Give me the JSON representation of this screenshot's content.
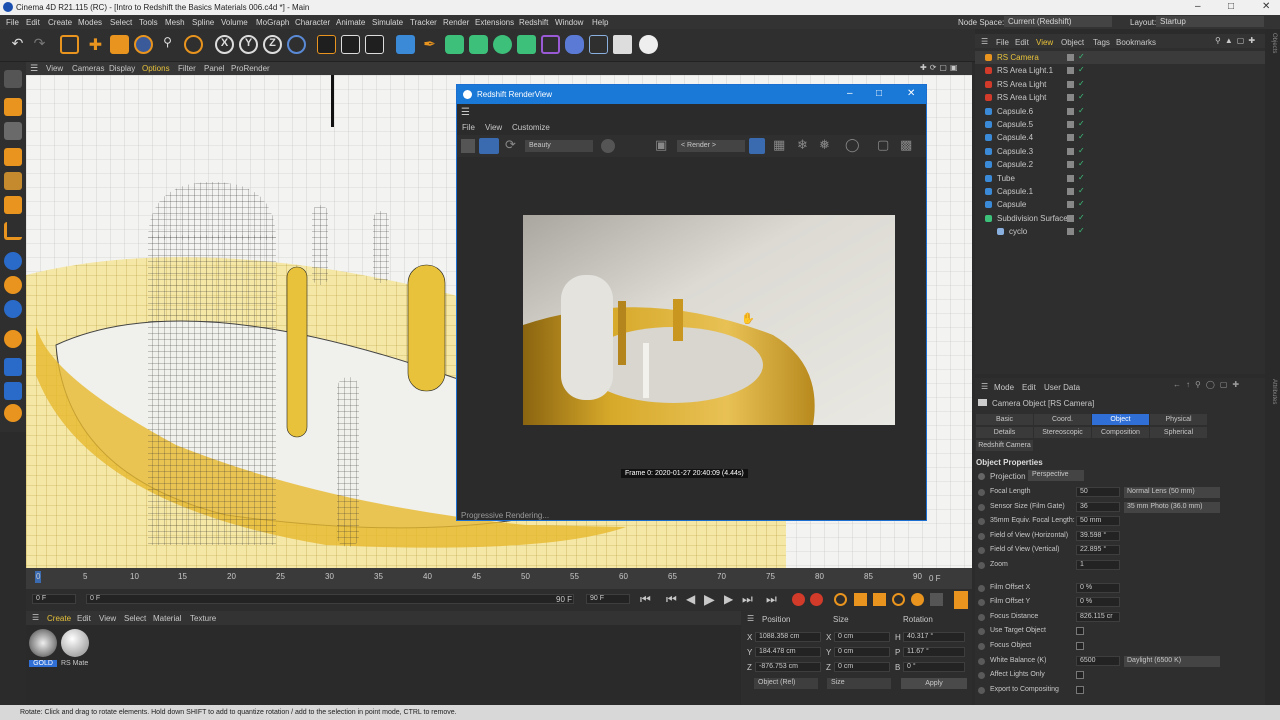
{
  "window": {
    "title": "Cinema 4D R21.115 (RC) - [Intro to Redshift the Basics Materials 006.c4d *] - Main"
  },
  "menu": [
    "File",
    "Edit",
    "Create",
    "Modes",
    "Select",
    "Tools",
    "Mesh",
    "Spline",
    "Volume",
    "MoGraph",
    "Character",
    "Animate",
    "Simulate",
    "Tracker",
    "Render",
    "Extensions",
    "Redshift",
    "Window",
    "Help"
  ],
  "nodespace": {
    "label": "Node Space:",
    "value": "Current (Redshift)"
  },
  "layout": {
    "label": "Layout:",
    "value": "Startup"
  },
  "viewport_menu": [
    "View",
    "Cameras",
    "Display",
    "Options",
    "Filter",
    "Panel",
    "ProRender"
  ],
  "render_view": {
    "title": "Redshift RenderView",
    "menu": [
      "File",
      "View",
      "Customize"
    ],
    "aov": "Beauty",
    "camera": "< Render >",
    "frame_info": "Frame 0:  2020-01-27  20:40:09  (4.44s)",
    "status": "Progressive Rendering..."
  },
  "objmgr_menu": [
    "File",
    "Edit",
    "View",
    "Object",
    "Tags",
    "Bookmarks"
  ],
  "objects": [
    {
      "name": "RS Camera",
      "indent": 0,
      "highlight": true
    },
    {
      "name": "RS Area Light.1",
      "indent": 0
    },
    {
      "name": "RS Area Light",
      "indent": 0
    },
    {
      "name": "RS Area Light",
      "indent": 0
    },
    {
      "name": "Capsule.6",
      "indent": 0
    },
    {
      "name": "Capsule.5",
      "indent": 0
    },
    {
      "name": "Capsule.4",
      "indent": 0
    },
    {
      "name": "Capsule.3",
      "indent": 0
    },
    {
      "name": "Capsule.2",
      "indent": 0
    },
    {
      "name": "Tube",
      "indent": 0
    },
    {
      "name": "Capsule.1",
      "indent": 0
    },
    {
      "name": "Capsule",
      "indent": 0
    },
    {
      "name": "Subdivision Surface",
      "indent": 0
    },
    {
      "name": "cyclo",
      "indent": 1
    }
  ],
  "attr_menu": [
    "Mode",
    "Edit",
    "User Data"
  ],
  "attr": {
    "object_title": "Camera Object [RS Camera]",
    "tabs_row1": [
      "Basic",
      "Coord.",
      "Object",
      "Physical"
    ],
    "tabs_row2": [
      "Details",
      "Stereoscopic",
      "Composition",
      "Spherical"
    ],
    "tab_extra": "Redshift Camera",
    "section": "Object Properties",
    "projection_label": "Projection",
    "projection_value": "Perspective",
    "props": [
      {
        "label": "Focal Length",
        "value": "50",
        "extra": "Normal Lens (50 mm)"
      },
      {
        "label": "Sensor Size (Film Gate)",
        "value": "36",
        "extra": "35 mm Photo (36.0 mm)"
      },
      {
        "label": "35mm Equiv. Focal Length:",
        "value": "50 mm",
        "extra": ""
      },
      {
        "label": "Field of View (Horizontal)",
        "value": "39.598 °",
        "extra": ""
      },
      {
        "label": "Field of View (Vertical)",
        "value": "22.895 °",
        "extra": ""
      },
      {
        "label": "Zoom",
        "value": "1",
        "extra": ""
      },
      {
        "label": "Film Offset X",
        "value": "0 %",
        "extra": ""
      },
      {
        "label": "Film Offset Y",
        "value": "0 %",
        "extra": ""
      },
      {
        "label": "Focus Distance",
        "value": "826.115 cr",
        "extra": ""
      },
      {
        "label": "Use Target Object",
        "value": "",
        "extra": ""
      },
      {
        "label": "Focus Object",
        "value": "",
        "extra": ""
      },
      {
        "label": "White Balance (K)",
        "value": "6500",
        "extra": "Daylight (6500 K)"
      },
      {
        "label": "Affect Lights Only",
        "value": "",
        "extra": ""
      },
      {
        "label": "Export to Compositing",
        "value": "",
        "extra": ""
      }
    ]
  },
  "timeline": {
    "ticks": [
      "0",
      "5",
      "10",
      "15",
      "20",
      "25",
      "30",
      "35",
      "40",
      "45",
      "50",
      "55",
      "60",
      "65",
      "70",
      "75",
      "80",
      "85",
      "90"
    ],
    "end_label": "0 F"
  },
  "transport": {
    "start": "0 F",
    "current": "0 F",
    "end": "90 F",
    "end2": "90 F"
  },
  "materials_menu": [
    "Create",
    "Edit",
    "View",
    "Select",
    "Material",
    "Texture"
  ],
  "materials": [
    {
      "name": "GOLD"
    },
    {
      "name": "RS Mate"
    }
  ],
  "coords": {
    "headers": [
      "Position",
      "Size",
      "Rotation"
    ],
    "rows": [
      {
        "axis": "X",
        "pos": "1088.358 cm",
        "size": "0 cm",
        "raxis": "H",
        "rot": "40.317 °"
      },
      {
        "axis": "Y",
        "pos": "184.478 cm",
        "size": "0 cm",
        "raxis": "P",
        "rot": "11.67 °"
      },
      {
        "axis": "Z",
        "pos": "-876.753 cm",
        "size": "0 cm",
        "raxis": "B",
        "rot": "0 °"
      }
    ],
    "mode": "Object (Rel)",
    "size_mode": "Size",
    "apply": "Apply"
  },
  "status": "Rotate: Click and drag to rotate elements. Hold down SHIFT to add to quantize rotation / add to the selection in point mode, CTRL to remove.",
  "colors": {
    "accent": "#2f6fd6",
    "gold": "#e6c23a",
    "titlebar_blue": "#1a78d6"
  }
}
